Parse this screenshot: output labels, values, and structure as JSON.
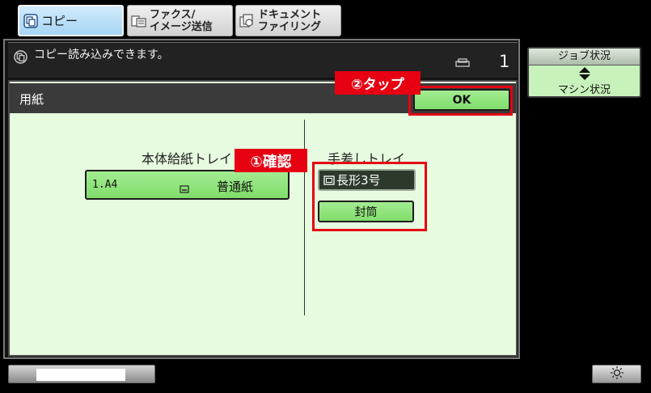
{
  "tabs": [
    {
      "label": "コピー",
      "icon": "copy-icon",
      "active": true
    },
    {
      "line1": "ファクス/",
      "line2": "イメージ送信",
      "icon": "fax-icon",
      "active": false
    },
    {
      "line1": "ドキュメント",
      "line2": "ファイリング",
      "icon": "document-filing-icon",
      "active": false
    }
  ],
  "status": {
    "icon": "copy-status-icon",
    "message": "コピー読み込みできます。",
    "count_icon": "copies-icon",
    "count": "1"
  },
  "job_status_button": {
    "top_label": "ジョブ状況",
    "icon": "up-down-arrow-icon",
    "bottom_label": "マシン状況"
  },
  "paper_settings": {
    "title": "用紙",
    "ok_label": "OK",
    "main_tray": {
      "label": "本体給紙トレイ",
      "size": "1.A4",
      "icon": "paper-tray-icon",
      "type": "普通紙"
    },
    "bypass_tray": {
      "label": "手差しトレイ",
      "size": "長形3号",
      "icon": "envelope-icon",
      "type": "封筒"
    }
  },
  "callouts": {
    "step1": "①確認",
    "step2": "②タップ"
  },
  "footer": {
    "brightness_icon": "brightness-icon"
  },
  "colors": {
    "background": "#000000",
    "active_tab": "#a6d5f5",
    "inactive_tab": "#d2d2d2",
    "panel": "#e6fbdf",
    "panel_header": "#3a3a3a",
    "button_green": "#80dd6b",
    "dark_button": "#2c3a2c",
    "callout_red": "#e60012",
    "job_status_bg": "#c8f2bb"
  }
}
